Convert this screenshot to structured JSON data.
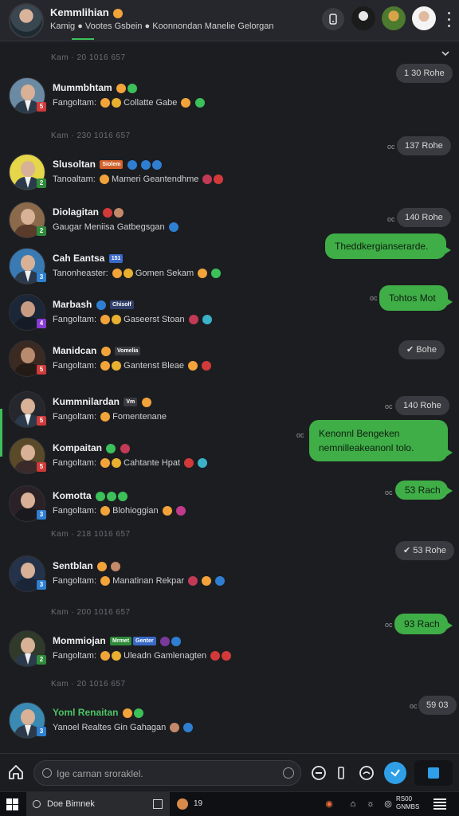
{
  "header": {
    "title": "Kemmlihian",
    "subtitle": "Kamig ● Vootes Gsbein ● Koonnondan Manelie Gelorgan"
  },
  "date_separators": [
    "Kam · 20 1016 657",
    "Kam · 230 1016 657",
    "Kam · 218 1016 657",
    "Kam · 200 1016 657",
    "Kam · 20 1016 657"
  ],
  "messages": [
    {
      "name": "Mummbhtam",
      "text": "Fangoltam:",
      "text2": "Collatte Gabe",
      "badge_color": "#d23a3a",
      "name_color": "#f1f1f1"
    },
    {
      "name": "Slusoltan",
      "tag": "Siolem",
      "text": "Tanoaltam:",
      "text2": "Mameri Geantendhme",
      "badge_color": "#2e8b3a",
      "name_color": "#f1f1f1"
    },
    {
      "name": "Diolagitan",
      "text": "Gaugar Meniisa Gatbegsgan",
      "text2": "",
      "badge_color": "#2e8b3a",
      "name_color": "#f1f1f1"
    },
    {
      "name": "Cah Eantsa",
      "tag": "151",
      "text": "Tanonheaster:",
      "text2": "Gomen Sekam",
      "badge_color": "#2e7fd1",
      "name_color": "#f1f1f1"
    },
    {
      "name": "Marbash",
      "tag": "Chisolf",
      "text": "Fangoltam:",
      "text2": "Gaseerst Stoan",
      "badge_color": "#8a3ad2",
      "name_color": "#f1f1f1"
    },
    {
      "name": "Manidcan",
      "tag": "Vomelia",
      "text": "Fangoltam:",
      "text2": "Gantenst Bleae",
      "badge_color": "#d23a3a",
      "name_color": "#f1f1f1"
    },
    {
      "name": "Kummnilardan",
      "tag": "Vm",
      "text": "Fangoltam:",
      "text2": "Fomentenane",
      "badge_color": "#d23a3a",
      "name_color": "#f1f1f1"
    },
    {
      "name": "Kompaitan",
      "text": "Fangoltam:",
      "text2": "Cahtante Hpat",
      "badge_color": "#d23a3a",
      "name_color": "#f1f1f1"
    },
    {
      "name": "Komotta",
      "text": "Fangoltam:",
      "text2": "Blohioggian",
      "badge_color": "#2e7fd1",
      "name_color": "#f1f1f1"
    },
    {
      "name": "Sentblan",
      "text": "Fangoltam:",
      "text2": "Manatinan Rekpar",
      "badge_color": "#2e7fd1",
      "name_color": "#f1f1f1"
    },
    {
      "name": "Mommiojan",
      "tag": "Mrmet",
      "tag2": "Genter",
      "text": "Fangoltam:",
      "text2": "Uleadn Gamlenagten",
      "badge_color": "#2e8b3a",
      "name_color": "#f1f1f1"
    },
    {
      "name": "Yoml Renaitan",
      "text": "Yanoel Realtes Gin Gahagan",
      "text2": "",
      "badge_color": "#2e7fd1",
      "name_color": "#4cc463"
    }
  ],
  "outgoing": {
    "times": [
      "1 30 Rohe",
      "137 Rohe",
      "140 Rohe",
      "✔ Bohe",
      "140 Rohe",
      "53 Rach",
      "✔ 53 Rohe",
      "93 Rach",
      "59 03"
    ],
    "bubbles": [
      "Theddkergianserarde.",
      "Tohtos Mot",
      "Kenonnl Bengeken nemnilleakeanonl tolo.",
      ""
    ]
  },
  "composer": {
    "placeholder": "Ige carnan sroraklel."
  },
  "taskbar": {
    "search_text": "Doe Bimnek",
    "count": "19",
    "clock_line1": "RS00",
    "clock_line2": "GNMBS"
  },
  "colors": {
    "accent_green": "#3fae47",
    "background": "#1c1d21",
    "header_bg": "#26272c",
    "badge_blue": "#2e7fd1",
    "badge_red": "#d23a3a"
  },
  "icons": [
    "home-icon",
    "search-icon",
    "timer-icon",
    "send-icon",
    "windows-start-icon",
    "more-vertical-icon",
    "chevron-down-icon",
    "notification-icon"
  ]
}
